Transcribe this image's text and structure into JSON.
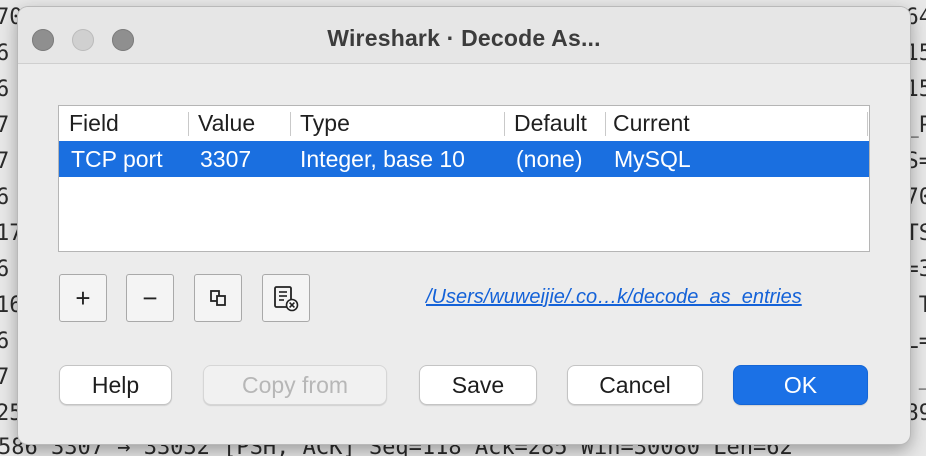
{
  "window": {
    "title": "Wireshark · Decode As..."
  },
  "table": {
    "columns": [
      "Field",
      "Value",
      "Type",
      "Default",
      "Current"
    ],
    "selected_row": {
      "field": "TCP port",
      "value": "3307",
      "type": "Integer, base 10",
      "default": "(none)",
      "current": "MySQL"
    }
  },
  "toolbar": {
    "add_label": "+",
    "remove_label": "−",
    "copy_icon": "copy-icon",
    "clear_icon": "clear-list-icon"
  },
  "path_link": "/Users/wuweijie/.co…k/decode_as_entries",
  "buttons": {
    "help": "Help",
    "copy_from": "Copy from",
    "save": "Save",
    "cancel": "Cancel",
    "ok": "OK"
  },
  "background": {
    "left_chars": [
      "70",
      "6",
      "6",
      "7",
      "7",
      "6",
      "17",
      "6",
      "16",
      "6",
      "7",
      "25"
    ],
    "right_chars": [
      "64",
      "15",
      "15",
      "_P",
      "S=",
      "70",
      "TS",
      "=3",
      "T",
      "L=",
      "_",
      "89"
    ],
    "bottom_line": "586 3307 → 33032 [PSH, ACK] Seq=118 Ack=285 Win=30080 Len=62"
  },
  "colors": {
    "selection": "#1a6fe0",
    "primary_button": "#1b71e6",
    "link": "#1462d8"
  }
}
